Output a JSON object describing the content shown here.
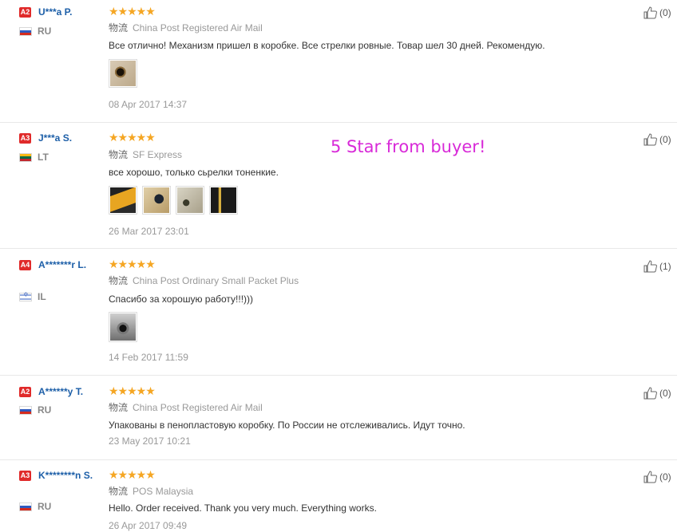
{
  "promo_text": "5 Star from buyer!",
  "logistics_label": "物流",
  "reviews": [
    {
      "level": "A2",
      "name": "U***a P.",
      "country": "RU",
      "stars": "★★★★★",
      "logistics": "China Post Registered Air Mail",
      "text": "Все отлично! Механизм пришел в коробке. Все стрелки ровные. Товар шел 30 дней. Рекомендую.",
      "date": "08 Apr 2017 14:37",
      "helpful": "(0)"
    },
    {
      "level": "A3",
      "name": "J***a S.",
      "country": "LT",
      "stars": "★★★★★",
      "logistics": "SF Express",
      "text": "все хорошо, только сьрелки тоненкие.",
      "date": "26 Mar 2017 23:01",
      "helpful": "(0)"
    },
    {
      "level": "A4",
      "name": "A*******r L.",
      "country": "IL",
      "stars": "★★★★★",
      "logistics": "China Post Ordinary Small Packet Plus",
      "text": "Спасибо за хорошую работу!!!)))",
      "date": "14 Feb 2017 11:59",
      "helpful": "(1)"
    },
    {
      "level": "A2",
      "name": "A******y T.",
      "country": "RU",
      "stars": "★★★★★",
      "logistics": "China Post Registered Air Mail",
      "text": "Упакованы в пенопластовую коробку. По России не отслеживались. Идут точно.",
      "date": "23 May 2017 10:21",
      "helpful": "(0)"
    },
    {
      "level": "A3",
      "name": "K********n S.",
      "country": "RU",
      "stars": "★★★★★",
      "logistics": "POS Malaysia",
      "text": "Hello. Order received. Thank you very much. Everything works.",
      "date": "26 Apr 2017 09:49",
      "helpful": "(0)"
    }
  ]
}
